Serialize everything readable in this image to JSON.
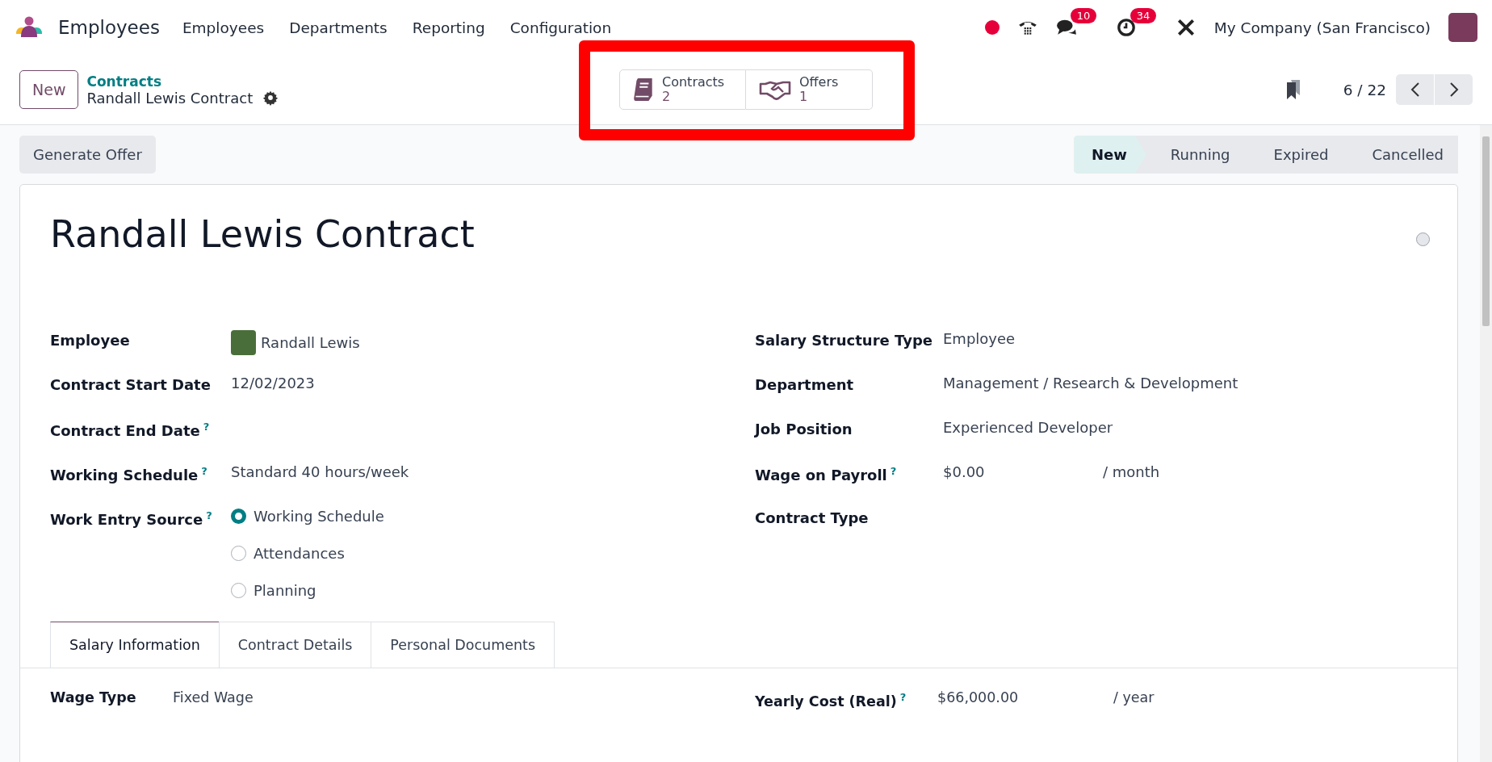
{
  "navbar": {
    "app_name": "Employees",
    "menu": [
      "Employees",
      "Departments",
      "Reporting",
      "Configuration"
    ],
    "chat_badge": "10",
    "activity_badge": "34",
    "company": "My Company (San Francisco)"
  },
  "control_panel": {
    "new_button": "New",
    "breadcrumb": "Contracts",
    "record_name": "Randall Lewis Contract",
    "smart_buttons_highlighted": true,
    "smart_buttons": [
      {
        "kind": "book",
        "label": "Contracts",
        "count": "2"
      },
      {
        "kind": "handshake",
        "label": "Offers",
        "count": "1"
      }
    ],
    "pager": "6 / 22"
  },
  "action_button": "Generate Offer",
  "statusbar": [
    {
      "label": "New",
      "selected": true
    },
    {
      "label": "Running",
      "selected": false
    },
    {
      "label": "Expired",
      "selected": false
    },
    {
      "label": "Cancelled",
      "selected": false
    }
  ],
  "form": {
    "title": "Randall Lewis Contract",
    "left_fields": [
      {
        "kind": "avatar",
        "label": "Employee",
        "value": "Randall Lewis"
      },
      {
        "kind": "text",
        "label": "Contract Start Date",
        "value": "12/02/2023"
      },
      {
        "kind": "text",
        "label": "Contract End Date",
        "help": "?"
      },
      {
        "kind": "text",
        "label": "Working Schedule",
        "help": "?",
        "value": "Standard 40 hours/week"
      },
      {
        "kind": "radio",
        "label": "Work Entry Source",
        "help": "?",
        "options": [
          {
            "label": "Working Schedule",
            "selected": true
          },
          {
            "label": "Attendances",
            "selected": false
          },
          {
            "label": "Planning",
            "selected": false
          }
        ]
      }
    ],
    "right_fields": [
      {
        "kind": "text",
        "label": "Salary Structure Type",
        "value": "Employee"
      },
      {
        "kind": "text",
        "label": "Department",
        "value": "Management / Research & Development"
      },
      {
        "kind": "text",
        "label": "Job Position",
        "value": "Experienced Developer"
      },
      {
        "kind": "monetary",
        "label": "Wage on Payroll",
        "help": "?",
        "value": "$0.00",
        "unit": "/ month"
      },
      {
        "kind": "text",
        "label": "Contract Type"
      }
    ],
    "tabs": [
      {
        "label": "Salary Information",
        "selected": true
      },
      {
        "label": "Contract Details",
        "selected": false
      },
      {
        "label": "Personal Documents",
        "selected": false
      }
    ],
    "tab_left": {
      "label": "Wage Type",
      "value": "Fixed Wage"
    },
    "tab_right": {
      "label": "Yearly Cost (Real)",
      "help": "?",
      "value": "$66,000.00",
      "unit": "/ year"
    }
  }
}
